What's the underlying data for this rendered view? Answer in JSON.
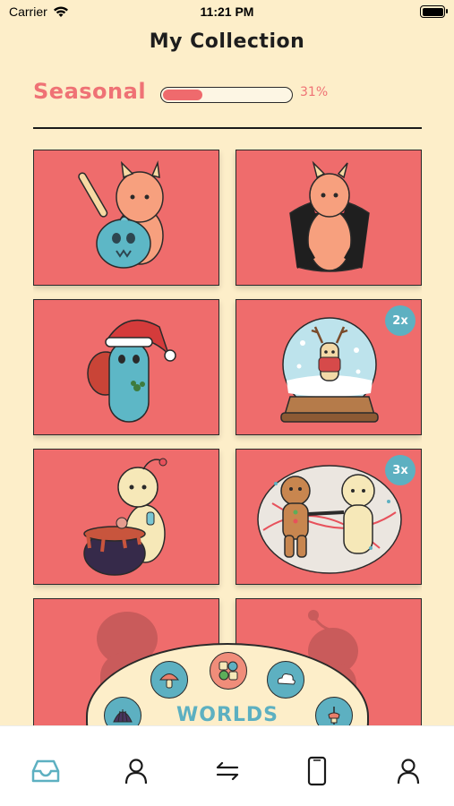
{
  "status": {
    "carrier": "Carrier",
    "time": "11:21 PM"
  },
  "title": "My Collection",
  "section": {
    "label": "Seasonal",
    "progress_percent": 31,
    "progress_text": "31%"
  },
  "cards": [
    {
      "name": "poison-apple-bunny",
      "badge": ""
    },
    {
      "name": "vampire-cape-bunny",
      "badge": ""
    },
    {
      "name": "santa-hat-creature",
      "badge": ""
    },
    {
      "name": "reindeer-snow-globe",
      "badge": "2x"
    },
    {
      "name": "cauldron-sprite",
      "badge": ""
    },
    {
      "name": "gingerbread-friends",
      "badge": "3x"
    },
    {
      "name": "locked-silhouette-1",
      "badge": ""
    },
    {
      "name": "locked-silhouette-2",
      "badge": ""
    }
  ],
  "worlds": {
    "label": "WORLDS",
    "items": [
      "shell-icon",
      "mushroom-icon",
      "seasonal-icon",
      "cloud-icon",
      "carousel-icon"
    ],
    "active": "seasonal-icon"
  },
  "tabs": [
    "collection-tab",
    "profile-tab",
    "trade-tab",
    "device-tab",
    "account-tab"
  ],
  "colors": {
    "background": "#fdeec9",
    "card": "#ef6c6c",
    "accent": "#ef7275",
    "teal": "#5db0c1",
    "active_tab": "#5db0c1"
  }
}
